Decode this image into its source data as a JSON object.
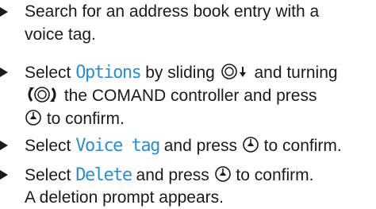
{
  "steps": [
    {
      "lines": [
        {
          "text": "Search for an address book entry with a"
        },
        {
          "text": "voice tag."
        }
      ]
    },
    {
      "line1": {
        "pre": "Select ",
        "highlight": "Options",
        "post": " by sliding ",
        "post2": " and turning"
      },
      "line2": {
        "text": " the COMAND controller and press"
      },
      "line3": {
        "text": " to confirm."
      }
    },
    {
      "line1": {
        "pre": "Select ",
        "highlight": "Voice tag",
        "post": " and press ",
        "post2": " to confirm."
      }
    },
    {
      "line1": {
        "pre": "Select ",
        "highlight": "Delete",
        "post": " and press ",
        "post2": " to confirm."
      },
      "line2": {
        "text": "A deletion prompt appears."
      }
    }
  ],
  "icons": {
    "slide": "controller-slide-down-icon",
    "turn": "controller-turn-icon",
    "press": "controller-press-icon"
  }
}
